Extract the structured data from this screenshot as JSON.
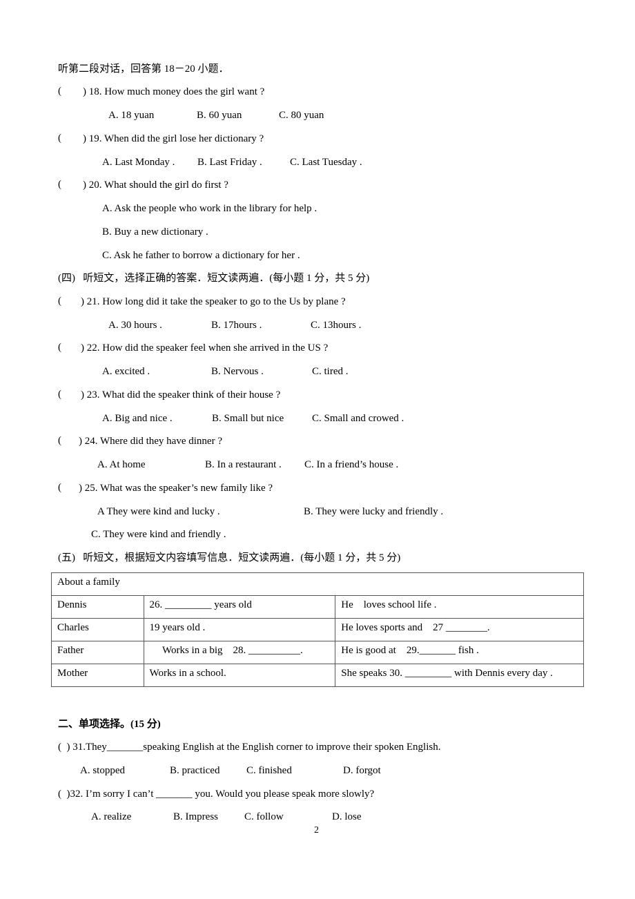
{
  "section3_header": "听第二段对话，回答第 18－20 小题．",
  "q18": {
    "q": ") 18. How much money does the girl want ?",
    "a": "A. 18 yuan",
    "b": "B. 60 yuan",
    "c": "C. 80 yuan"
  },
  "q19": {
    "q": ") 19. When did the girl lose her dictionary ?",
    "a": "A. Last Monday .",
    "b": "B. Last Friday .",
    "c": "C. Last Tuesday ."
  },
  "q20": {
    "q": ") 20. What should the girl do first ?",
    "a": "A. Ask the people who work in the library for help .",
    "b": "B. Buy a new dictionary .",
    "c": "C. Ask he father to borrow a dictionary for her ."
  },
  "section4_header": "(四)   听短文，选择正确的答案．短文读两遍．(每小题 1 分，共 5 分)",
  "q21": {
    "q": ") 21. How long did it take the speaker to go to the Us by plane ?",
    "a": "A. 30 hours .",
    "b": "B. 17hours .",
    "c": "C. 13hours ."
  },
  "q22": {
    "q": ") 22. How did the speaker feel when she arrived in the US ?",
    "a": "A. excited .",
    "b": "B. Nervous .",
    "c": "C. tired ."
  },
  "q23": {
    "q": ") 23. What did the speaker think of their house ?",
    "a": "A. Big and nice .",
    "b": "B. Small but nice",
    "c": "C. Small and crowed ."
  },
  "q24": {
    "q": ") 24. Where did they have dinner ?",
    "a": "A. At home",
    "b": "B. In a restaurant .",
    "c": "C. In a friend’s house ."
  },
  "q25": {
    "q": ") 25. What was the speaker’s new family like ?",
    "a": "A They were kind and lucky .",
    "b": "B. They were lucky and friendly .",
    "c": "C. They were kind and friendly ."
  },
  "section5_header": "(五)   听短文，根据短文内容填写信息．短文读两遍．(每小题 1 分，共 5 分)",
  "paren_open": "(",
  "table": {
    "title": "About a family",
    "rows": [
      [
        "Dennis",
        "26. _________ years old",
        "He    loves school life ."
      ],
      [
        "Charles",
        "19 years old .",
        "He loves sports and    27 ________."
      ],
      [
        "Father",
        "     Works in a big    28. __________.",
        "He is good at    29._______ fish ."
      ],
      [
        "Mother",
        "Works in a school.",
        "She speaks 30. _________ with Dennis every day ."
      ]
    ]
  },
  "part2_header": "二、单项选择。(15 分)",
  "q31": {
    "q": "(  ) 31.They_______speaking English at the English corner to improve their spoken English.",
    "a": "A. stopped",
    "b": "B. practiced",
    "c": "C. finished",
    "d": "D. forgot"
  },
  "q32": {
    "q": "(  )32. I’m sorry I can’t _______ you. Would you please speak more slowly?",
    "a": "A. realize",
    "b": "B. Impress",
    "c": "C. follow",
    "d": "D. lose"
  },
  "page_number": "2"
}
